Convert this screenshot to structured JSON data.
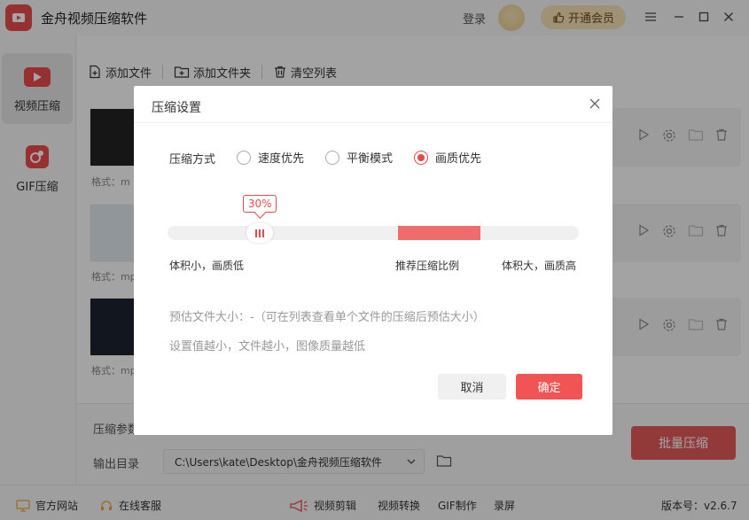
{
  "app": {
    "title": "金舟视频压缩软件",
    "login": "登录",
    "vip_label": "开通会员"
  },
  "sidebar": {
    "items": [
      {
        "label": "视频压缩",
        "icon": "video-compress-icon"
      },
      {
        "label": "GIF压缩",
        "icon": "gif-compress-icon"
      }
    ]
  },
  "toolbar": {
    "add_file": "添加文件",
    "add_folder": "添加文件夹",
    "clear_list": "清空列表"
  },
  "files": [
    {
      "format_label": "格式：m"
    },
    {
      "format_label": "格式：mp"
    },
    {
      "format_label": "格式：mp"
    }
  ],
  "bottom": {
    "param_label": "压缩参数",
    "output_label": "输出目录",
    "output_path": "C:\\Users\\kate\\Desktop\\金舟视频压缩软件",
    "batch_button": "批量压缩"
  },
  "footer": {
    "official_site": "官方网站",
    "online_service": "在线客服",
    "links": [
      "视频剪辑",
      "视频转换",
      "GIF制作",
      "录屏"
    ],
    "version": "版本号：v2.6.7"
  },
  "dialog": {
    "title": "压缩设置",
    "mode_label": "压缩方式",
    "modes": [
      {
        "label": "速度优先",
        "selected": false
      },
      {
        "label": "平衡模式",
        "selected": false
      },
      {
        "label": "画质优先",
        "selected": true
      }
    ],
    "slider_value": 30,
    "slider_value_text": "30%",
    "recommended_range": [
      56,
      76
    ],
    "scale_left": "体积小，画质低",
    "scale_mid": "推荐压缩比例",
    "scale_right": "体积大，画质高",
    "estimate_text": "预估文件大小：-（可在列表查看单个文件的压缩后预估大小）",
    "note_text": "设置值越小，文件越小，图像质量越低",
    "cancel": "取消",
    "ok": "确定"
  },
  "colors": {
    "accent": "#e84a4a",
    "recommended": "#f06b6b",
    "vip_bg": "#f3dfb6"
  }
}
